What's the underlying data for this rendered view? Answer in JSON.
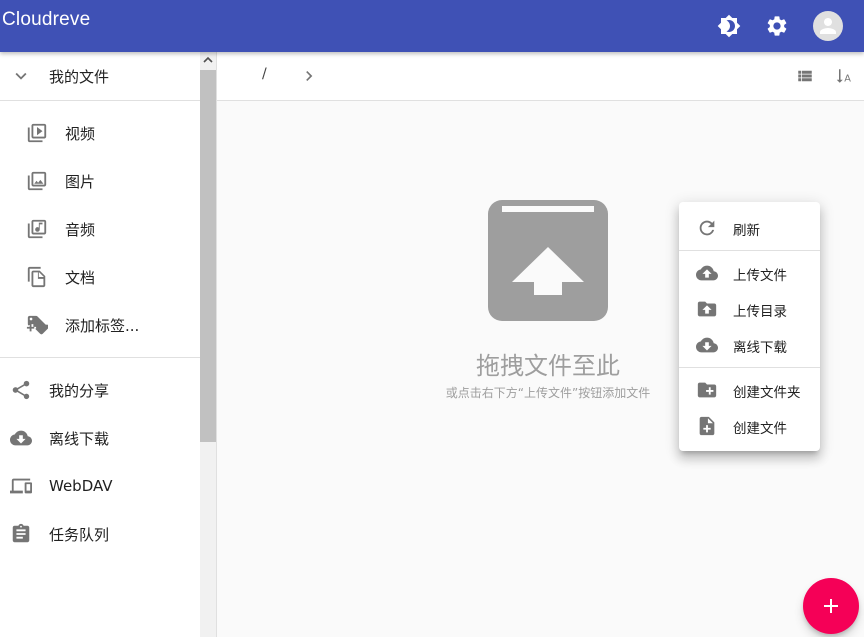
{
  "app": {
    "title": "Cloudreve"
  },
  "header": {
    "icons": [
      "theme-toggle-icon",
      "settings-icon",
      "account-icon"
    ]
  },
  "sidebar": {
    "my_files": "我的文件",
    "items": [
      {
        "label": "视频",
        "icon": "video-library-icon"
      },
      {
        "label": "图片",
        "icon": "photo-library-icon"
      },
      {
        "label": "音频",
        "icon": "music-library-icon"
      },
      {
        "label": "文档",
        "icon": "document-copy-icon"
      },
      {
        "label": "添加标签...",
        "icon": "tag-add-icon"
      }
    ],
    "nav": [
      {
        "label": "我的分享",
        "icon": "share-icon"
      },
      {
        "label": "离线下载",
        "icon": "cloud-download-icon"
      },
      {
        "label": "WebDAV",
        "icon": "devices-icon"
      },
      {
        "label": "任务队列",
        "icon": "task-clipboard-icon"
      }
    ]
  },
  "toolbar": {
    "path_separator": "/"
  },
  "empty_state": {
    "title": "拖拽文件至此",
    "subtitle": "或点击右下方“上传文件”按钮添加文件"
  },
  "context_menu": {
    "refresh": "刷新",
    "upload_file": "上传文件",
    "upload_folder": "上传目录",
    "offline_download": "离线下载",
    "new_folder": "创建文件夹",
    "new_file": "创建文件"
  },
  "colors": {
    "appbar": "#3f51b5",
    "fab": "#f50057",
    "icon_gray": "#757575"
  }
}
